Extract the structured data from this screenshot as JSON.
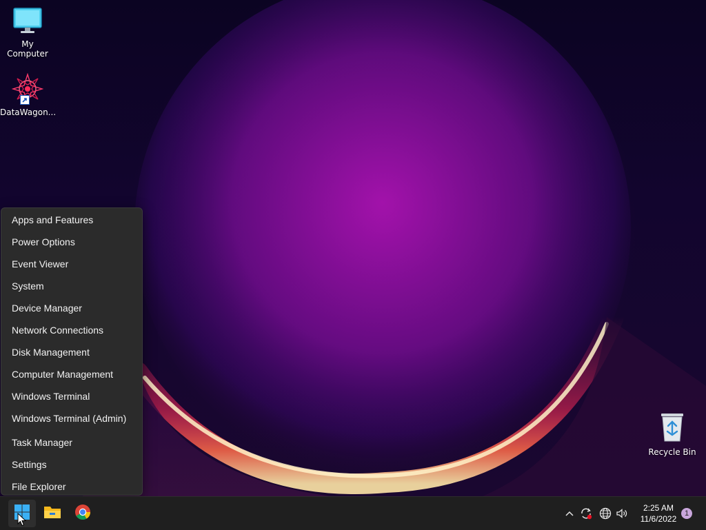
{
  "desktop": {
    "icons": [
      {
        "label": "My Computer",
        "icon": "monitor-icon"
      },
      {
        "label": "DataWagon...",
        "icon": "datawagon-logo-icon",
        "shortcut": true
      },
      {
        "label": "Recycle Bin",
        "icon": "recycle-bin-icon"
      }
    ]
  },
  "winx_menu": {
    "items": [
      {
        "label": "Apps and Features"
      },
      {
        "label": "Power Options"
      },
      {
        "label": "Event Viewer"
      },
      {
        "label": "System"
      },
      {
        "label": "Device Manager"
      },
      {
        "label": "Network Connections"
      },
      {
        "label": "Disk Management"
      },
      {
        "label": "Computer Management"
      },
      {
        "label": "Windows Terminal"
      },
      {
        "label": "Windows Terminal (Admin)"
      },
      {
        "label": "Task Manager"
      },
      {
        "label": "Settings"
      },
      {
        "label": "File Explorer"
      }
    ]
  },
  "taskbar": {
    "pinned": [
      {
        "name": "start-button",
        "icon": "windows-logo-icon"
      },
      {
        "name": "file-explorer-button",
        "icon": "folder-icon"
      },
      {
        "name": "chrome-button",
        "icon": "chrome-icon"
      }
    ],
    "tray": {
      "icons": [
        "chevron-up-icon",
        "sync-icon",
        "globe-icon",
        "speaker-icon"
      ],
      "time": "2:25 AM",
      "date": "11/6/2022",
      "notification_count": "1"
    }
  },
  "colors": {
    "accent": "#0078d4",
    "menu_bg": "#2b2b2b",
    "taskbar_bg": "#1f1f1f",
    "badge": "#c9a6dc"
  }
}
